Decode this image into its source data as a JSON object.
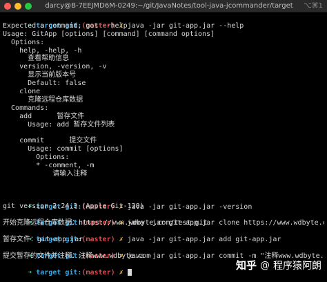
{
  "window": {
    "title": "darcy@B-7EEJMD6M-0249:~/git/JavaNotes/tool-java-jcommander/target",
    "shortcut": "⌥⌘1"
  },
  "prompt": {
    "arrow": "➜",
    "dir": "target",
    "git": "git:",
    "open_paren": "(",
    "branch": "master",
    "close_paren": ")",
    "mark": "✗"
  },
  "terminal": {
    "cmd1": "java -jar git-app.jar --help",
    "out1": [
      "Expected a command, got --help",
      "Usage: GitApp [options] [command] [command options]",
      "  Options:",
      "    help, -help, -h",
      "      查看帮助信息",
      "    version, -version, -v",
      "      显示当前版本号",
      "      Default: false",
      "    clone",
      "      克隆远程仓库数据",
      "  Commands:",
      "    add      暂存文件",
      "      Usage: add 暂存文件列表",
      "",
      "    commit      提交文件",
      "      Usage: commit [options]",
      "        Options:",
      "        * -comment, -m",
      "            请输入注释",
      "",
      ""
    ],
    "cmd2": "java -jar git-app.jar -version",
    "out2": "git version 2.24.3 (Apple Git-128)",
    "cmd3": "java -jar git-app.jar clone https://www.wdbyte.com/test.git",
    "out3": "开始克隆远程仓库数据：https://www.wdbyte.com/test.git",
    "cmd4": "java -jar git-app.jar add git-app.jar",
    "out4": "暂存文件：git-app.jar",
    "cmd5": "java -jar git-app.jar commit -m \"注释www.wdbyte.com\"",
    "out5": "提交暂存的文件并注释：注释www.wdbyte.com"
  },
  "watermark": {
    "brand": "知乎",
    "at": "@",
    "author": "程序猿阿朗"
  },
  "colors": {
    "background": "#000000",
    "text": "#d8d8d8",
    "arrow": "#2ec27e",
    "dir": "#3aa6e0",
    "branch": "#d84a4a",
    "mark": "#e3b341"
  }
}
